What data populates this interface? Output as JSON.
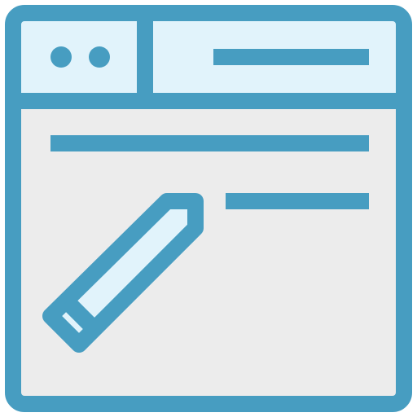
{
  "icon": {
    "semantic_name": "browser-window-edit-icon",
    "colors": {
      "stroke": "#479dc1",
      "header_fill": "#e1f3fb",
      "body_fill": "#ececec",
      "pencil_fill": "#e1f3fb"
    }
  }
}
